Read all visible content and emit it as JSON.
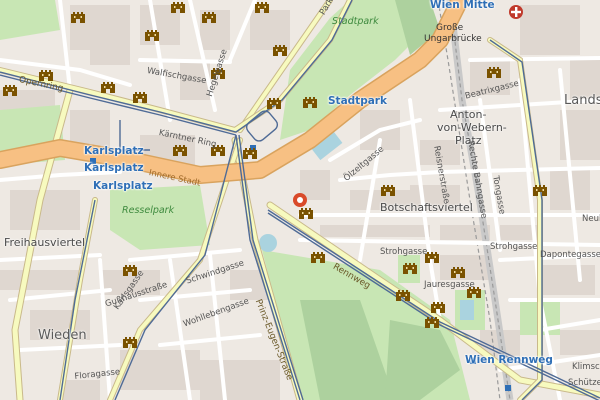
{
  "map": {
    "labels": {
      "wien_mitte": "Wien Mitte",
      "stadtpark_park": "Stadtpark",
      "stadtpark_station": "Stadtpark",
      "grosse_ungarbruecke_1": "Große",
      "grosse_ungarbruecke_2": "Ungarbrücke",
      "landstrasse": "Landst",
      "anton_webern_1": "Anton-",
      "anton_webern_2": "von-Webern-",
      "anton_webern_3": "Platz",
      "botschaftsviertel": "Botschaftsviertel",
      "karlsplatz_1": "Karlsplatz",
      "karlsplatz_2": "Karlsplatz",
      "karlsplatz_3": "Karlsplatz",
      "resselpark": "Resselpark",
      "freihausviertel": "Freihausviertel",
      "wieden": "Wieden",
      "wien_rennweg": "Wien Rennweg",
      "opernring": "Opernring",
      "rennweg": "Rennweg",
      "prinz_eugen": "Prinz-Eugen-Straße",
      "walfischgasse": "Walfischgasse",
      "hegelgasse": "Hegelgasse",
      "kaerntner_ring": "Kärntner Ring",
      "innere_stadt": "Innere Stadt",
      "ozelgasse": "Ölzeltgasse",
      "reisnerstrasse": "Reisnerstraße",
      "rechte_bahngasse": "Rechte Bahngasse",
      "beatrixgasse": "Beatrixgasse",
      "tongasse": "Tongasse",
      "strohgasse_1": "Strohgasse",
      "strohgasse_2": "Strohgasse",
      "jauresgasse": "Jauresgasse",
      "dapontegasse": "Dapontegasse",
      "neul": "Neul",
      "schwindgasse": "Schwindgasse",
      "wohllebengasse": "Wohllebengasse",
      "karlsgasse": "Karlsgasse",
      "gusshausstrasse": "Gußhausstraße",
      "floragasse": "Floragasse",
      "klimsch": "Klimsch",
      "schutzen": "Schützen",
      "parkring": "Park"
    },
    "colors": {
      "background": "#eee9e3",
      "building": "#d9d0c9",
      "park": "#c8e6b4",
      "park_dark": "#add19e",
      "water": "#aad3df",
      "ring_road": "#f7c083",
      "primary_road": "#fcd6a4",
      "secondary_road": "#f7fabf",
      "tram": "#4f6b96",
      "station_blue": "#2f6fb6",
      "castle_icon": "#7a5200",
      "marker": "#d94a2a"
    },
    "icons": {
      "castle": "castle-icon",
      "location_marker": "location-pin-icon",
      "hospital": "hospital-icon"
    }
  }
}
